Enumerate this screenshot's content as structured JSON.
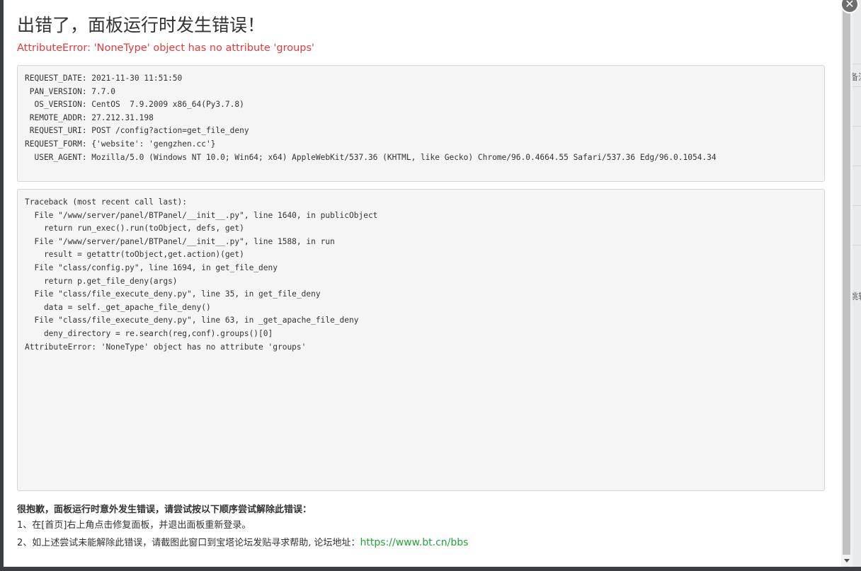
{
  "dialog": {
    "title": "出错了，面板运行时发生错误！",
    "error_message": "AttributeError: 'NoneType' object has no attribute 'groups'",
    "request_info": "REQUEST_DATE: 2021-11-30 11:51:50\n PAN_VERSION: 7.7.0\n  OS_VERSION: CentOS  7.9.2009 x86_64(Py3.7.8)\n REMOTE_ADDR: 27.212.31.198\n REQUEST_URI: POST /config?action=get_file_deny\nREQUEST_FORM: {'website': 'gengzhen.cc'}\n  USER_AGENT: Mozilla/5.0 (Windows NT 10.0; Win64; x64) AppleWebKit/537.36 (KHTML, like Gecko) Chrome/96.0.4664.55 Safari/537.36 Edg/96.0.1054.34",
    "traceback": "Traceback (most recent call last):\n  File \"/www/server/panel/BTPanel/__init__.py\", line 1640, in publicObject\n    return run_exec().run(toObject, defs, get)\n  File \"/www/server/panel/BTPanel/__init__.py\", line 1588, in run\n    result = getattr(toObject,get.action)(get)\n  File \"class/config.py\", line 1694, in get_file_deny\n    return p.get_file_deny(args)\n  File \"class/file_execute_deny.py\", line 35, in get_file_deny\n    data = self._get_apache_file_deny()\n  File \"class/file_execute_deny.py\", line 63, in _get_apache_file_deny\n    deny_directory = re.search(reg,conf).groups()[0]\nAttributeError: 'NoneType' object has no attribute 'groups'",
    "help_heading": "很抱歉，面板运行时意外发生错误，请尝试按以下顺序尝试解除此错误：",
    "help_step1": "1、在[首页]右上角点击修复面板，并退出面板重新登录。",
    "help_step2_prefix": "2、如上述尝试未能解除此错误，请截图此窗口到宝塔论坛发贴寻求帮助, 论坛地址：",
    "forum_link": "https://www.bt.cn/bbs",
    "close_icon": "close-icon"
  },
  "background": {
    "hint1": "备注",
    "hint2": "跳转"
  },
  "colors": {
    "error_red": "#e23b3b",
    "link_green": "#20a53a",
    "box_bg": "#f5f5f5"
  }
}
